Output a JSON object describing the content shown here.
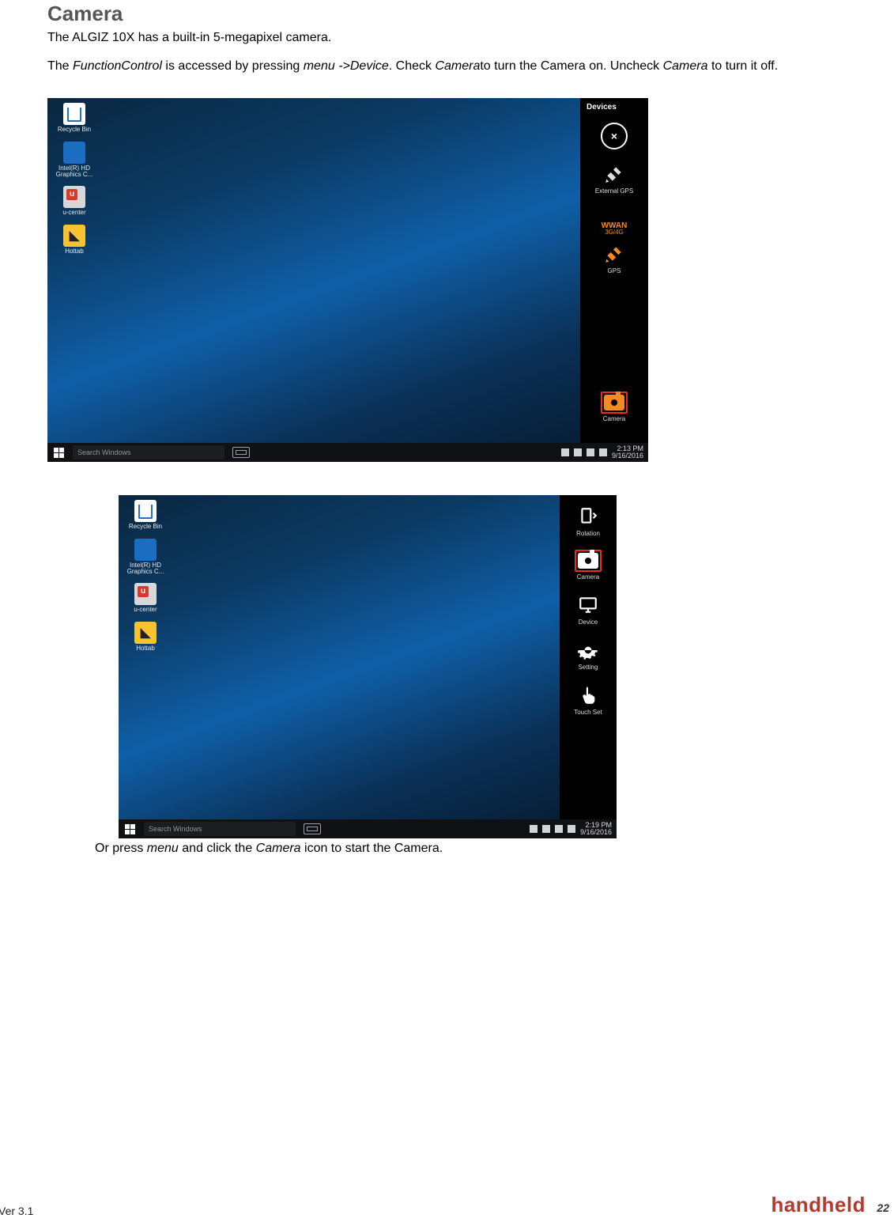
{
  "heading": "Camera",
  "intro": "The ALGIZ 10X has a built-in 5-megapixel camera.",
  "para2_parts": {
    "a": "The ",
    "b": "FunctionControl",
    "c": " is accessed by pressing ",
    "d": "menu ->Device",
    "e": ". Check ",
    "f": "Camera",
    "g": "to turn the Camera on. Uncheck ",
    "h": "Camera",
    "i": " to turn it off."
  },
  "desktop_icons": {
    "recycle": "Recycle Bin",
    "intel": "Intel(R) HD Graphics C...",
    "ucenter": "u-center",
    "hottab": "Hottab"
  },
  "panel1": {
    "title": "Devices",
    "close": "×",
    "ext_gps": "External GPS",
    "wwan": "WWAN",
    "wwan_sub": "3G/4G",
    "gps": "GPS",
    "camera": "Camera"
  },
  "panel2": {
    "rotation": "Rotation",
    "camera": "Camera",
    "device": "Device",
    "setting": "Setting",
    "touch": "Touch Set"
  },
  "taskbar": {
    "search_placeholder": "Search Windows",
    "time1": "2:13 PM",
    "date1": "9/16/2016",
    "time2": "2:19 PM",
    "date2": "9/16/2016"
  },
  "caption_parts": {
    "a": "Or press ",
    "b": "menu",
    "c": " and click the ",
    "d": "Camera",
    "e": " icon to start the Camera."
  },
  "footer": {
    "ver": "Ver 3.1",
    "brand": "handheld",
    "page": "22"
  }
}
